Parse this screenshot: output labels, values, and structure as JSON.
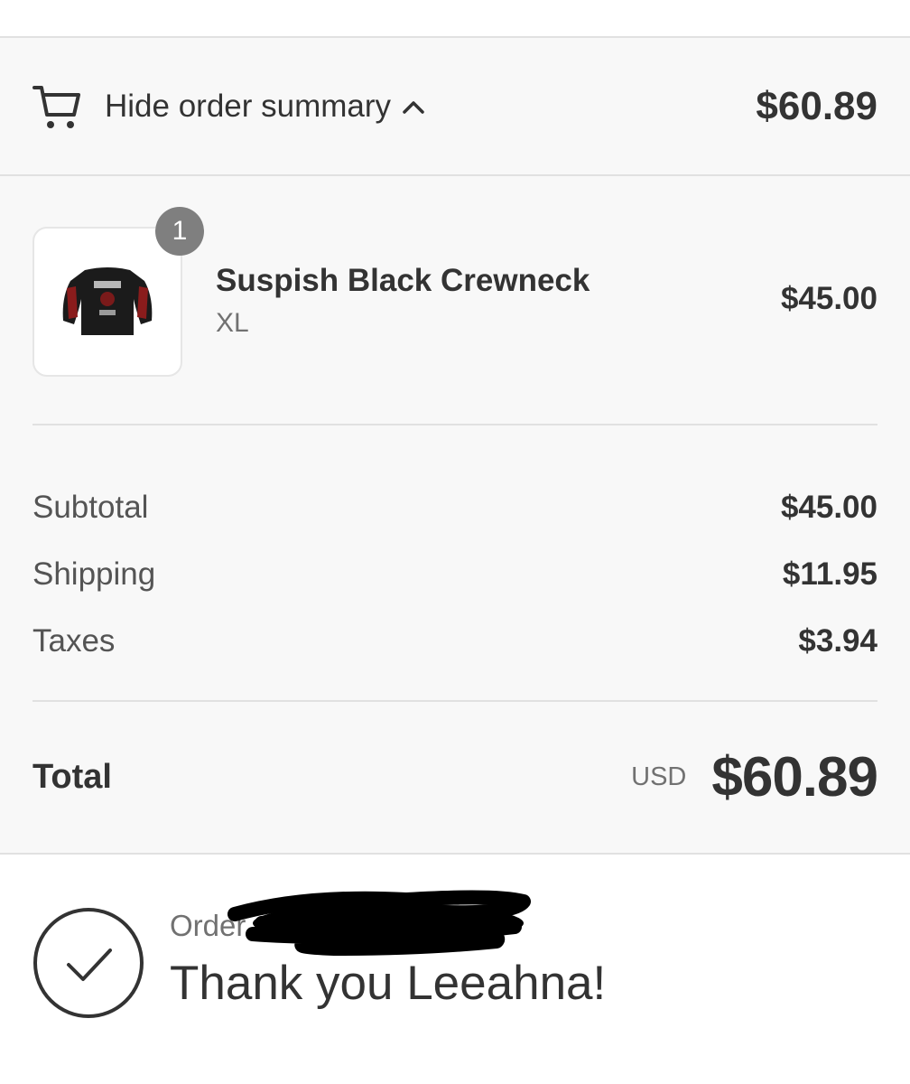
{
  "summary_toggle": {
    "icon": "cart-icon",
    "label": "Hide order summary",
    "chevron_icon": "chevron-up-icon",
    "total": "$60.89"
  },
  "line_items": [
    {
      "quantity": "1",
      "name": "Suspish Black Crewneck",
      "variant": "XL",
      "price": "$45.00",
      "image_icon": "crewneck-sweatshirt-image"
    }
  ],
  "costs": {
    "subtotal_label": "Subtotal",
    "subtotal_value": "$45.00",
    "shipping_label": "Shipping",
    "shipping_value": "$11.95",
    "taxes_label": "Taxes",
    "taxes_value": "$3.94"
  },
  "total": {
    "label": "Total",
    "currency": "USD",
    "amount": "$60.89"
  },
  "confirmation": {
    "icon": "check-circle-icon",
    "order_label": "Order",
    "message": "Thank you Leeahna!"
  },
  "colors": {
    "background": "#f8f8f8",
    "divider": "#e1e1e1",
    "text": "#333333",
    "muted_text": "#717171",
    "badge": "#7f7f7f"
  }
}
